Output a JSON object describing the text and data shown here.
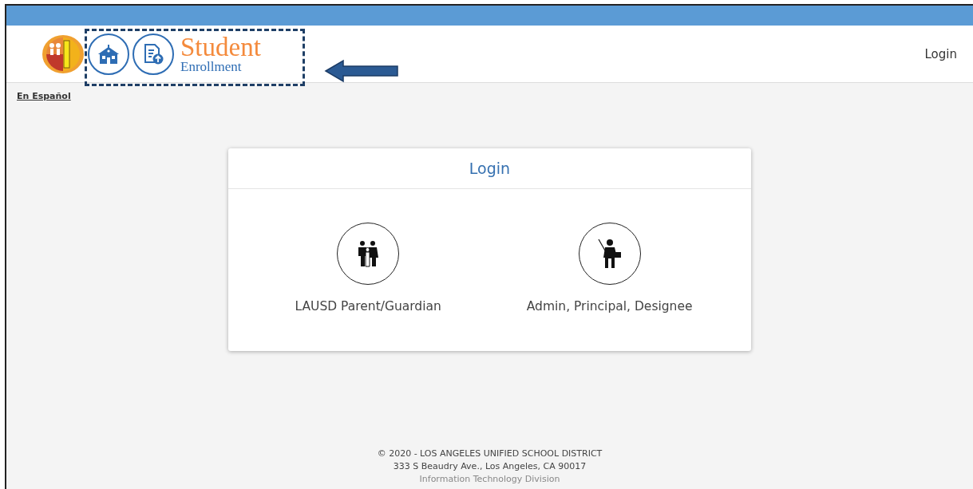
{
  "header": {
    "brand_title": "Student",
    "brand_subtitle": "Enrollment",
    "nav_link": "Login"
  },
  "language_link": "En Español",
  "login_card": {
    "title": "Login",
    "options": [
      {
        "kind": "parent",
        "label": "LAUSD Parent/Guardian"
      },
      {
        "kind": "staff",
        "label": "Admin, Principal, Designee"
      }
    ]
  },
  "footer": [
    "© 2020 - LOS ANGELES UNIFIED SCHOOL DISTRICT",
    "333 S Beaudry Ave., Los Angeles, CA 90017",
    "Information Technology Division"
  ]
}
